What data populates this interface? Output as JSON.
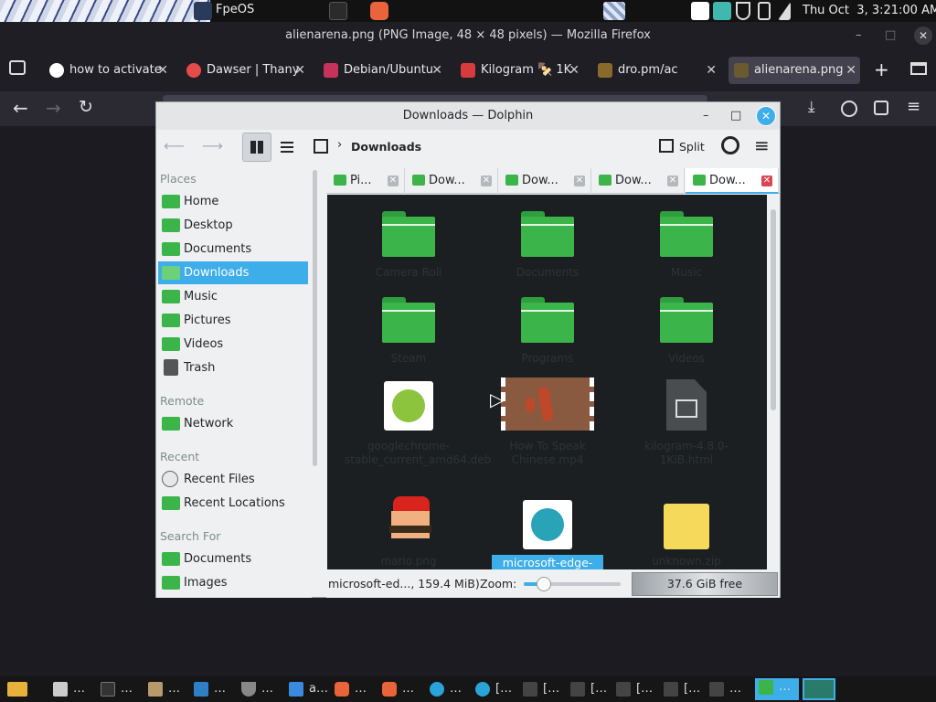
{
  "topbar": {
    "app_name": "FpeOS",
    "clock": "Thu Oct  3, 3:21:00 AM"
  },
  "firefox": {
    "window_title": "alienarena.png (PNG Image, 48 × 48 pixels) — Mozilla Firefox",
    "tabs": [
      {
        "label": "how to activate"
      },
      {
        "label": "Dawser | Thany"
      },
      {
        "label": "Debian/Ubuntu"
      },
      {
        "label": "Kilogram 🍢 1K"
      },
      {
        "label": "dro.pm/ac"
      },
      {
        "label": "alienarena.png"
      }
    ]
  },
  "dolphin": {
    "title": "Downloads — Dolphin",
    "breadcrumb": "Downloads",
    "split_label": "Split",
    "places": {
      "places_header": "Places",
      "places_items": [
        "Home",
        "Desktop",
        "Documents",
        "Downloads",
        "Music",
        "Pictures",
        "Videos",
        "Trash"
      ],
      "remote_header": "Remote",
      "remote_items": [
        "Network"
      ],
      "recent_header": "Recent",
      "recent_items": [
        "Recent Files",
        "Recent Locations"
      ],
      "search_header": "Search For",
      "search_items": [
        "Documents",
        "Images"
      ]
    },
    "tabs": [
      "Pi...",
      "Dow...",
      "Dow...",
      "Dow...",
      "Dow..."
    ],
    "files": [
      {
        "name": "Camera Roll"
      },
      {
        "name": "Documents"
      },
      {
        "name": "Music"
      },
      {
        "name": "Steam"
      },
      {
        "name": "Programs"
      },
      {
        "name": "Videos"
      },
      {
        "name": "googlechrome-stable_current_amd64.deb"
      },
      {
        "name": "How To Speak Chinese.mp4"
      },
      {
        "name": "kilogram-4.8.0-1KiB.html"
      },
      {
        "name": "mario.png"
      },
      {
        "name": "microsoft-edge-"
      },
      {
        "name": "unknown.zip"
      }
    ],
    "status": {
      "selection": "microsoft-ed..., 159.4 MiB)",
      "zoom_label": "Zoom:",
      "zoom_level": 0.15,
      "free_space": "37.6 GiB free"
    }
  },
  "taskbar": {
    "items": [
      "…",
      "…",
      "…",
      "…",
      "…",
      "a…",
      "…",
      "…",
      "…",
      "[…",
      "[…",
      "[…",
      "[…",
      "[…",
      "…"
    ]
  }
}
